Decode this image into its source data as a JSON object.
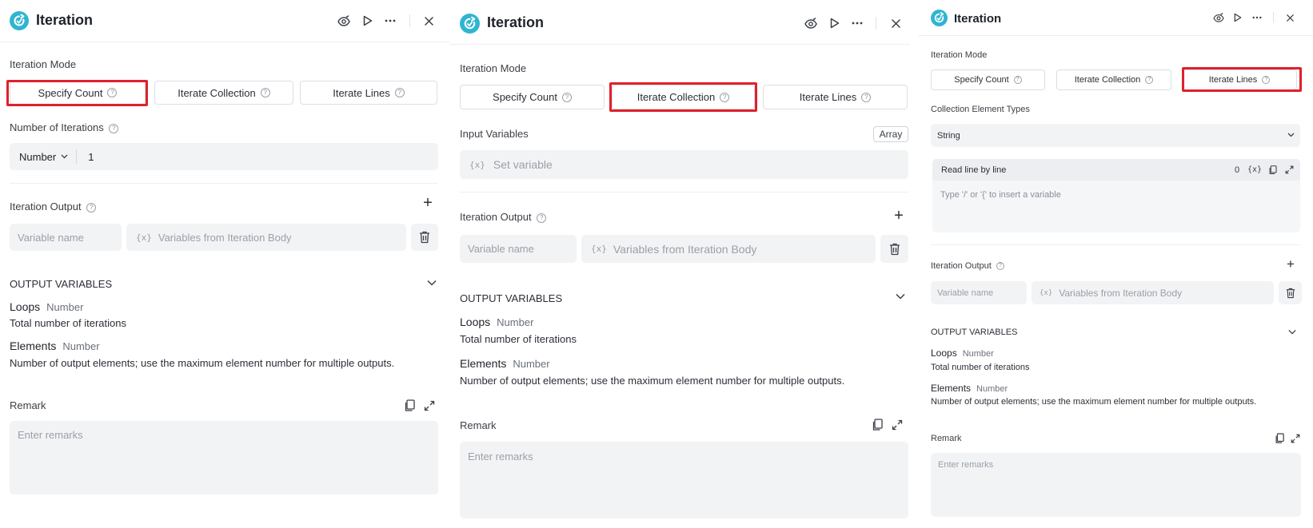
{
  "colors": {
    "accent": "#2fb5d0",
    "highlight": "#e0202b",
    "field_bg": "#f2f3f5"
  },
  "header": {
    "title": "Iteration",
    "icons": [
      "iteration-icon",
      "eye-check-icon",
      "play-icon",
      "more-icon",
      "close-icon"
    ]
  },
  "common": {
    "iteration_mode_label": "Iteration Mode",
    "modes": [
      "Specify Count",
      "Iterate Collection",
      "Iterate Lines"
    ],
    "iteration_output_label": "Iteration Output",
    "variable_name_placeholder": "Variable name",
    "variables_from_body_placeholder": "Variables from Iteration Body",
    "var_prefix": "{x}",
    "output_variables_label": "OUTPUT VARIABLES",
    "loops_name": "Loops",
    "loops_type": "Number",
    "loops_desc": "Total number of iterations",
    "elements_name": "Elements",
    "elements_type": "Number",
    "elements_desc": "Number of output elements; use the maximum element number for multiple outputs.",
    "remark_label": "Remark",
    "remark_placeholder": "Enter remarks",
    "help_glyph": "?",
    "plus_glyph": "+"
  },
  "panel1": {
    "selected_mode": "Specify Count",
    "number_of_iterations_label": "Number of Iterations",
    "type_select": "Number",
    "value": "1"
  },
  "panel2": {
    "selected_mode": "Iterate Collection",
    "input_variables_label": "Input Variables",
    "array_badge": "Array",
    "set_variable_placeholder": "Set variable"
  },
  "panel3": {
    "selected_mode": "Iterate Lines",
    "collection_element_types_label": "Collection Element Types",
    "element_type_select": "String",
    "editor_title": "Read line by line",
    "editor_count": "0",
    "editor_placeholder": "Type '/' or '{' to insert a variable"
  }
}
